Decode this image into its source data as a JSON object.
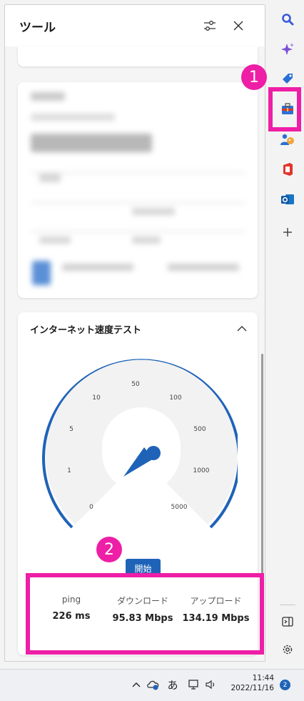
{
  "panel": {
    "title": "ツール"
  },
  "speed_test": {
    "title": "インターネット速度テスト",
    "gauge_labels": [
      "0",
      "1",
      "5",
      "10",
      "50",
      "100",
      "500",
      "1000",
      "5000"
    ],
    "start_label": "開始",
    "stats": [
      {
        "label": "ping",
        "value": "226 ms"
      },
      {
        "label": "ダウンロード",
        "value": "95.83 Mbps"
      },
      {
        "label": "アップロード",
        "value": "134.19 Mbps"
      }
    ]
  },
  "annotations": {
    "badge_1": "1",
    "badge_2": "2",
    "color": "#ee1ea6"
  },
  "sidebar": {
    "items": [
      "search-icon",
      "copilot-icon",
      "shopping-tag-icon",
      "tools-icon",
      "games-icon",
      "office-icon",
      "outlook-icon",
      "add-icon"
    ],
    "bottom": [
      "sidebar-panel-icon",
      "settings-icon"
    ]
  },
  "taskbar": {
    "ime_label": "あ",
    "time": "11:44",
    "date": "2022/11/16",
    "notification_count": "2"
  },
  "accent_color": "#1f63b8"
}
